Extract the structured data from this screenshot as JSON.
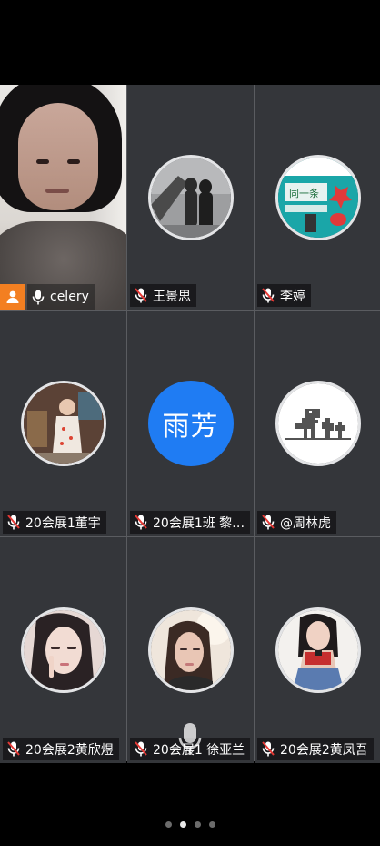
{
  "participants": [
    {
      "name": "celery",
      "type": "video",
      "host": true
    },
    {
      "name": "王景思",
      "type": "avatar",
      "avatar": "silhouettes-photo"
    },
    {
      "name": "李婷",
      "type": "avatar",
      "avatar": "graffiti-photo"
    },
    {
      "name": "20会展1董宇",
      "type": "avatar",
      "avatar": "child-photo"
    },
    {
      "name": "20会展1班  黎…",
      "type": "text-avatar",
      "avatar_text": "雨芳"
    },
    {
      "name": "@周林虎",
      "type": "avatar",
      "avatar": "dinosaur-icon"
    },
    {
      "name": "20会展2黄欣煜",
      "type": "avatar",
      "avatar": "girl-portrait-photo"
    },
    {
      "name": "20会展1 徐亚兰",
      "type": "avatar",
      "avatar": "girl-sunlight-photo"
    },
    {
      "name": "20会展2黄凤吾",
      "type": "avatar",
      "avatar": "girl-posing-photo"
    }
  ],
  "colors": {
    "accent": "#1f7cf3",
    "host_badge": "#f37f21",
    "muted_mic": "#e53935",
    "tile_bg": "#34363a"
  },
  "pagination": {
    "pages": 4,
    "current": 2
  }
}
